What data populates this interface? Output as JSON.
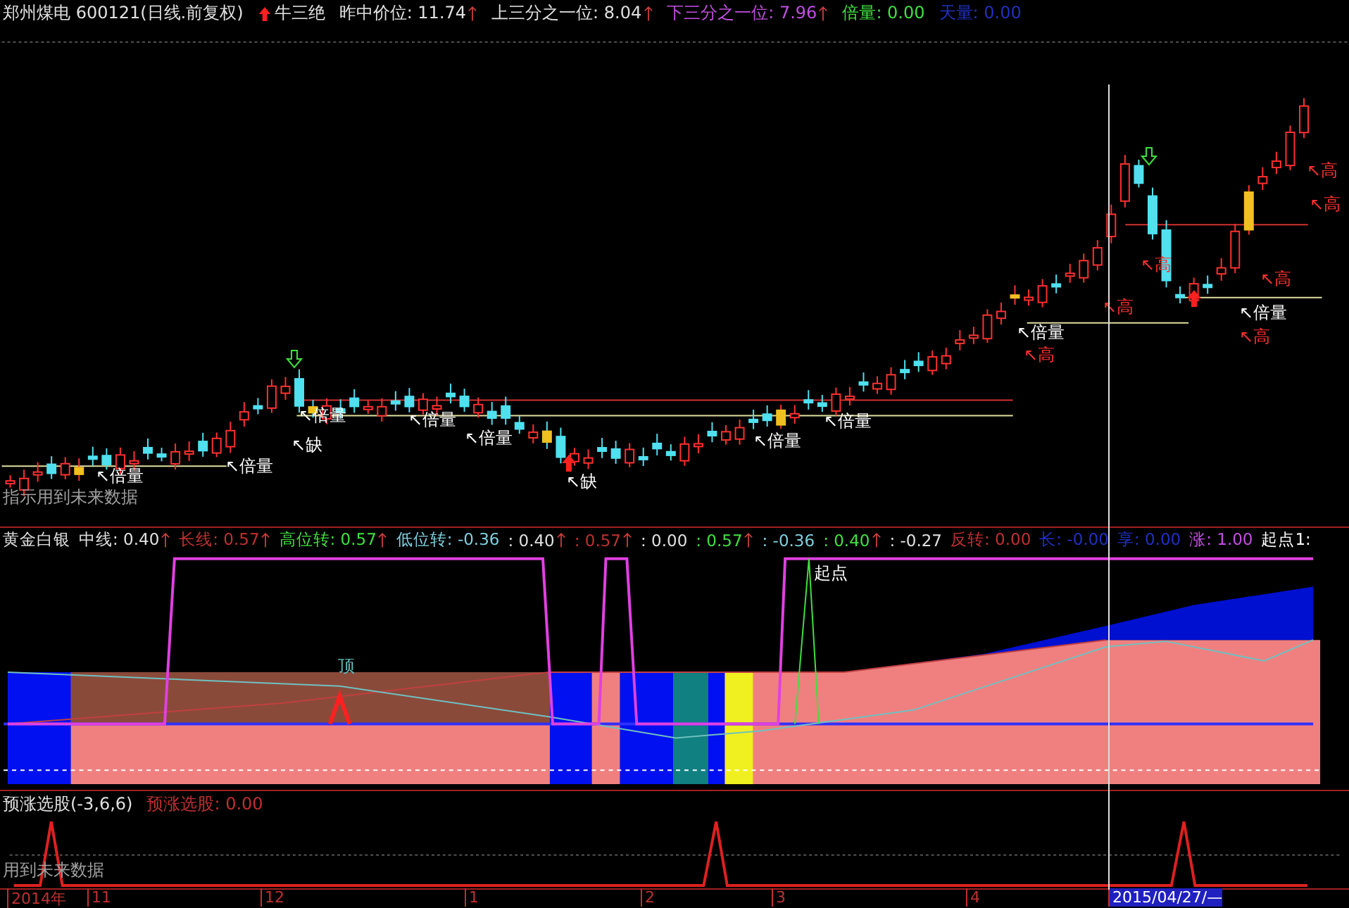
{
  "price_panel": {
    "title": "郑州煤电 600121(日线.前复权)",
    "signal": "牛三绝",
    "legend": [
      {
        "text": "昨中价位: 11.74",
        "arrow": true,
        "color": "#e0e0e0"
      },
      {
        "text": "上三分之一位: 8.04",
        "arrow": true,
        "color": "#e0e0e0"
      },
      {
        "text": "下三分之一位: 7.96",
        "arrow": true,
        "color": "#c050e0"
      },
      {
        "text": "倍量: 0.00",
        "arrow": false,
        "color": "#40e040"
      },
      {
        "text": "天量: 0.00",
        "arrow": false,
        "color": "#2030c0"
      }
    ],
    "annotations": [
      {
        "text": "↖倍量",
        "kind": "volume"
      },
      {
        "text": "↖倍量",
        "kind": "volume"
      },
      {
        "text": "↖倍量",
        "kind": "volume"
      },
      {
        "text": "↖缺",
        "kind": "gap"
      },
      {
        "text": "↖倍量",
        "kind": "volume"
      },
      {
        "text": "↖倍量",
        "kind": "volume"
      },
      {
        "text": "↖缺",
        "kind": "gap"
      },
      {
        "text": "↖倍量",
        "kind": "volume"
      },
      {
        "text": "↖倍量",
        "kind": "volume"
      },
      {
        "text": "↖倍量",
        "kind": "volume"
      },
      {
        "text": "↖高",
        "kind": "high"
      },
      {
        "text": "↖高",
        "kind": "high"
      },
      {
        "text": "↖高",
        "kind": "high"
      },
      {
        "text": "↖倍量",
        "kind": "volume"
      },
      {
        "text": "↖高",
        "kind": "high"
      },
      {
        "text": "↖高",
        "kind": "high"
      },
      {
        "text": "↖高",
        "kind": "high"
      },
      {
        "text": "↖高",
        "kind": "high"
      }
    ],
    "note": "指示用到未来数据"
  },
  "indicator_panel": {
    "title": "黄金白银",
    "legend": [
      {
        "text": "中线: 0.40",
        "arrow": true,
        "color": "#e0e0e0"
      },
      {
        "text": "长线: 0.57",
        "arrow": true,
        "color": "#c03030"
      },
      {
        "text": "高位转: 0.57",
        "arrow": true,
        "color": "#40e040"
      },
      {
        "text": "低位转: -0.36",
        "arrow": false,
        "color": "#80d0e0"
      },
      {
        "text": ": 0.40",
        "arrow": true,
        "color": "#e0e0e0"
      },
      {
        "text": ": 0.57",
        "arrow": true,
        "color": "#c03030"
      },
      {
        "text": ": 0.00",
        "arrow": false,
        "color": "#e0e0e0"
      },
      {
        "text": ": 0.57",
        "arrow": true,
        "color": "#40e040"
      },
      {
        "text": ": -0.36",
        "arrow": false,
        "color": "#80d0e0"
      },
      {
        "text": ": 0.40",
        "arrow": true,
        "color": "#40e040"
      },
      {
        "text": ": -0.27",
        "arrow": false,
        "color": "#e0e0e0"
      },
      {
        "text": "反转: 0.00",
        "arrow": false,
        "color": "#c03030"
      },
      {
        "text": "长: -0.00",
        "arrow": false,
        "color": "#2030c0"
      },
      {
        "text": "享: 0.00",
        "arrow": false,
        "color": "#2030c0"
      },
      {
        "text": "涨: 1.00",
        "arrow": false,
        "color": "#c050e0"
      },
      {
        "text": "起点1:",
        "arrow": false,
        "color": "#ffffff"
      }
    ],
    "peak_label": "顶",
    "start_label": "起点"
  },
  "signal_panel": {
    "title": "预涨选股(-3,6,6)",
    "legend": [
      {
        "text": "预涨选股: 0.00",
        "arrow": false,
        "color": "#c03030"
      }
    ],
    "note": "用到未来数据"
  },
  "time_axis": [
    {
      "text": "2014年",
      "kind": "tick"
    },
    {
      "text": "11",
      "kind": "tick"
    },
    {
      "text": "12",
      "kind": "tick"
    },
    {
      "text": "1",
      "kind": "tick"
    },
    {
      "text": "2",
      "kind": "tick"
    },
    {
      "text": "3",
      "kind": "tick"
    },
    {
      "text": "4",
      "kind": "tick"
    },
    {
      "text": "2015/04/27/—",
      "kind": "cursor"
    }
  ]
}
